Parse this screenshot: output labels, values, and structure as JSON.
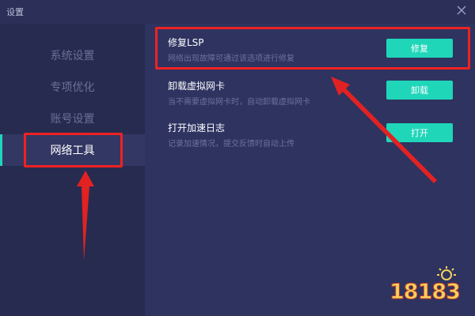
{
  "window": {
    "title": "设置"
  },
  "sidebar": {
    "items": [
      {
        "label": "系统设置",
        "active": false
      },
      {
        "label": "专项优化",
        "active": false
      },
      {
        "label": "账号设置",
        "active": false
      },
      {
        "label": "网络工具",
        "active": true
      }
    ]
  },
  "tools": [
    {
      "title": "修复LSP",
      "description": "网络出现故障可通过该选项进行修复",
      "button": "修复"
    },
    {
      "title": "卸载虚拟网卡",
      "description": "当不需要虚拟网卡时，自动卸载虚拟网卡",
      "button": "卸载"
    },
    {
      "title": "打开加速日志",
      "description": "记录加速情况，提交反馈时自动上传",
      "button": "打开"
    }
  ],
  "watermark": {
    "text": "18183"
  },
  "colors": {
    "accent": "#1fd6b9",
    "highlight": "#e22222",
    "background": "#2c3058"
  }
}
